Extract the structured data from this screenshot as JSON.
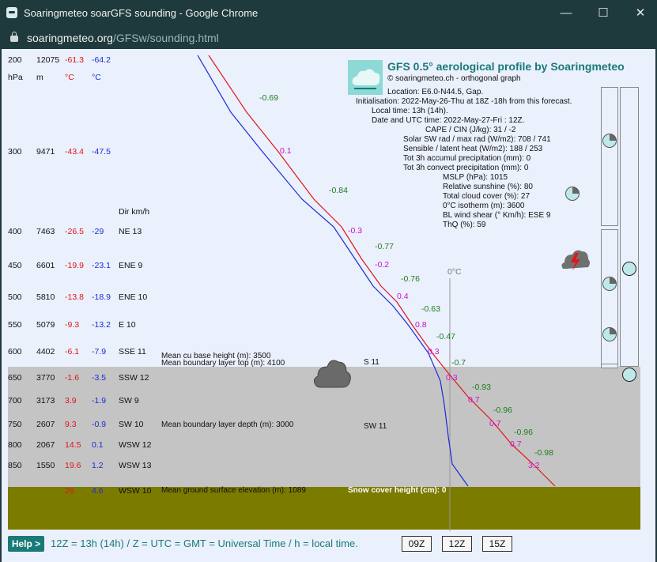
{
  "window": {
    "title": "Soaringmeteo soarGFS sounding - Google Chrome"
  },
  "address": {
    "domain": "soaringmeteo.org",
    "path": "/GFSw/sounding.html"
  },
  "header_row": {
    "pres": "200",
    "alt": "12075",
    "temp": "-61.3",
    "dew": "-64.2"
  },
  "units": {
    "pres": "hPa",
    "alt": "m",
    "temp": "°C",
    "dew": "°C",
    "wind": "Dir km/h"
  },
  "levels": [
    {
      "pres": "300",
      "alt": "9471",
      "temp": "-43.4",
      "dew": "-47.5",
      "wind": ""
    },
    {
      "pres": "400",
      "alt": "7463",
      "temp": "-26.5",
      "dew": "-29",
      "wind": "NE 13"
    },
    {
      "pres": "450",
      "alt": "6601",
      "temp": "-19.9",
      "dew": "-23.1",
      "wind": "ENE 9"
    },
    {
      "pres": "500",
      "alt": "5810",
      "temp": "-13.8",
      "dew": "-18.9",
      "wind": "ENE 10"
    },
    {
      "pres": "550",
      "alt": "5079",
      "temp": "-9.3",
      "dew": "-13.2",
      "wind": "E 10"
    },
    {
      "pres": "600",
      "alt": "4402",
      "temp": "-6.1",
      "dew": "-7.9",
      "wind": "SSE 11"
    },
    {
      "pres": "650",
      "alt": "3770",
      "temp": "-1.6",
      "dew": "-3.5",
      "wind": "SSW 12"
    },
    {
      "pres": "700",
      "alt": "3173",
      "temp": "3.9",
      "dew": "-1.9",
      "wind": "SW 9"
    },
    {
      "pres": "750",
      "alt": "2607",
      "temp": "9.3",
      "dew": "-0.9",
      "wind": "SW 10"
    },
    {
      "pres": "800",
      "alt": "2067",
      "temp": "14.5",
      "dew": "0.1",
      "wind": "WSW 12"
    },
    {
      "pres": "850",
      "alt": "1550",
      "temp": "19.6",
      "dew": "1.2",
      "wind": "WSW 13"
    }
  ],
  "ground_row": {
    "temp": "26",
    "dew": "4.6",
    "wind": "WSW 10"
  },
  "gfs": {
    "title": "GFS 0.5° aerological profile by Soaringmeteo",
    "subtitle": "© soaringmeteo.ch - orthogonal graph",
    "location": "Location: E6.0-N44.5, Gap.",
    "initialisation": "Initialisation: 2022-May-26-Thu at 18Z -18h from this forecast.",
    "local_time": "Local time: 13h (14h).",
    "date_utc": "Date and UTC time: 2022-May-27-Fri : 12Z.",
    "params": [
      "CAPE / CIN (J/kg): 31 / -2",
      "Solar SW rad / max rad (W/m2): 708 / 741",
      "Sensible / latent heat (W/m2): 188 / 253",
      "Tot 3h accumul precipitation (mm): 0",
      "Tot 3h convect precipitation (mm): 0",
      "MSLP (hPa): 1015",
      "Relative sunshine (%): 80",
      "Total cloud cover (%): 27",
      "0°C isotherm (m): 3600",
      "BL wind shear (° Km/h): ESE 9",
      "ThQ (%): 59"
    ]
  },
  "lapse_rates": [
    "-0.69",
    "-0.84",
    "-0.77",
    "-0.76",
    "-0.63",
    "-0.47",
    "-0.7",
    "-0.93",
    "-0.96",
    "-0.96",
    "-0.98"
  ],
  "diffs": [
    "0.1",
    "-0.3",
    "-0.2",
    "0.4",
    "0.8",
    "0.3",
    "0.3",
    "0.7",
    "0.7",
    "0.7",
    "3.2"
  ],
  "zero_c": "0°C",
  "annotations": {
    "cu_base": "Mean cu base height (m): 3500",
    "bl_top": "Mean boundary layer top (m): 4100",
    "bl_depth": "Mean boundary layer depth (m): 3000",
    "ground_elev": "Mean ground surface elevation (m): 1089",
    "snow": "Snow cover height (cm): 0",
    "s11": "S 11",
    "sw11": "SW 11"
  },
  "footer": {
    "help": "Help >",
    "text": "12Z = 13h (14h)  /  Z = UTC = GMT = Universal Time / h = local time.",
    "buttons": [
      "09Z",
      "12Z",
      "15Z"
    ]
  },
  "colors": {
    "titlebar": "#1f3a3d",
    "temp_line": "#e0161b",
    "dew_line": "#1a2cd6",
    "accent": "#197a77"
  },
  "icons": [
    "cloud-icon",
    "thunderstorm-icon",
    "pie-cloud-cover-icon",
    "lock-icon"
  ]
}
